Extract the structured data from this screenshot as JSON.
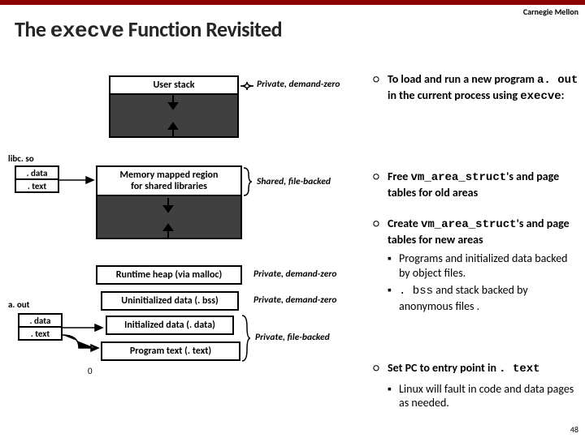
{
  "brand": "Carnegie Mellon",
  "title_pre": "The ",
  "title_code": "execve",
  "title_post": " Function Revisited",
  "labels": {
    "libc": "libc. so",
    "datatext1a": ". data",
    "datatext1b": ". text",
    "aout": "a. out",
    "datatext2a": ". data",
    "datatext2b": ". text",
    "zero": "0"
  },
  "boxes": {
    "userstack": "User stack",
    "mmap": "Memory mapped region\nfor shared libraries",
    "heap": "Runtime heap (via malloc)",
    "bss": "Uninitialized data (. bss)",
    "data": "Initialized data (. data)",
    "text": "Program text (. text)"
  },
  "notes": {
    "n1": "Private, demand-zero",
    "n2": "Shared, file-backed",
    "n3": "Private, demand-zero",
    "n4": "Private, demand-zero",
    "n5": "Private, file-backed"
  },
  "bullets": {
    "b1a": "To load and run a new program ",
    "b1code": "a. out",
    "b1b": " in the current process using ",
    "b1code2": "execve",
    "b1c": ":",
    "b2a": "Free ",
    "b2code": "vm_area_struct",
    "b2b": "'s and page tables for old areas",
    "b3a": "Create ",
    "b3code": "vm_area_struct",
    "b3b": "'s and page tables for new areas",
    "b3s1": "Programs and initialized data backed by object files.",
    "b3s2a": "",
    "b3s2code": ". bss",
    "b3s2b": " and stack backed by anonymous files .",
    "b4a": "Set PC to entry point in ",
    "b4code": ". text",
    "b4s1": "Linux will fault in code and data pages as needed."
  },
  "pagenum": "48"
}
